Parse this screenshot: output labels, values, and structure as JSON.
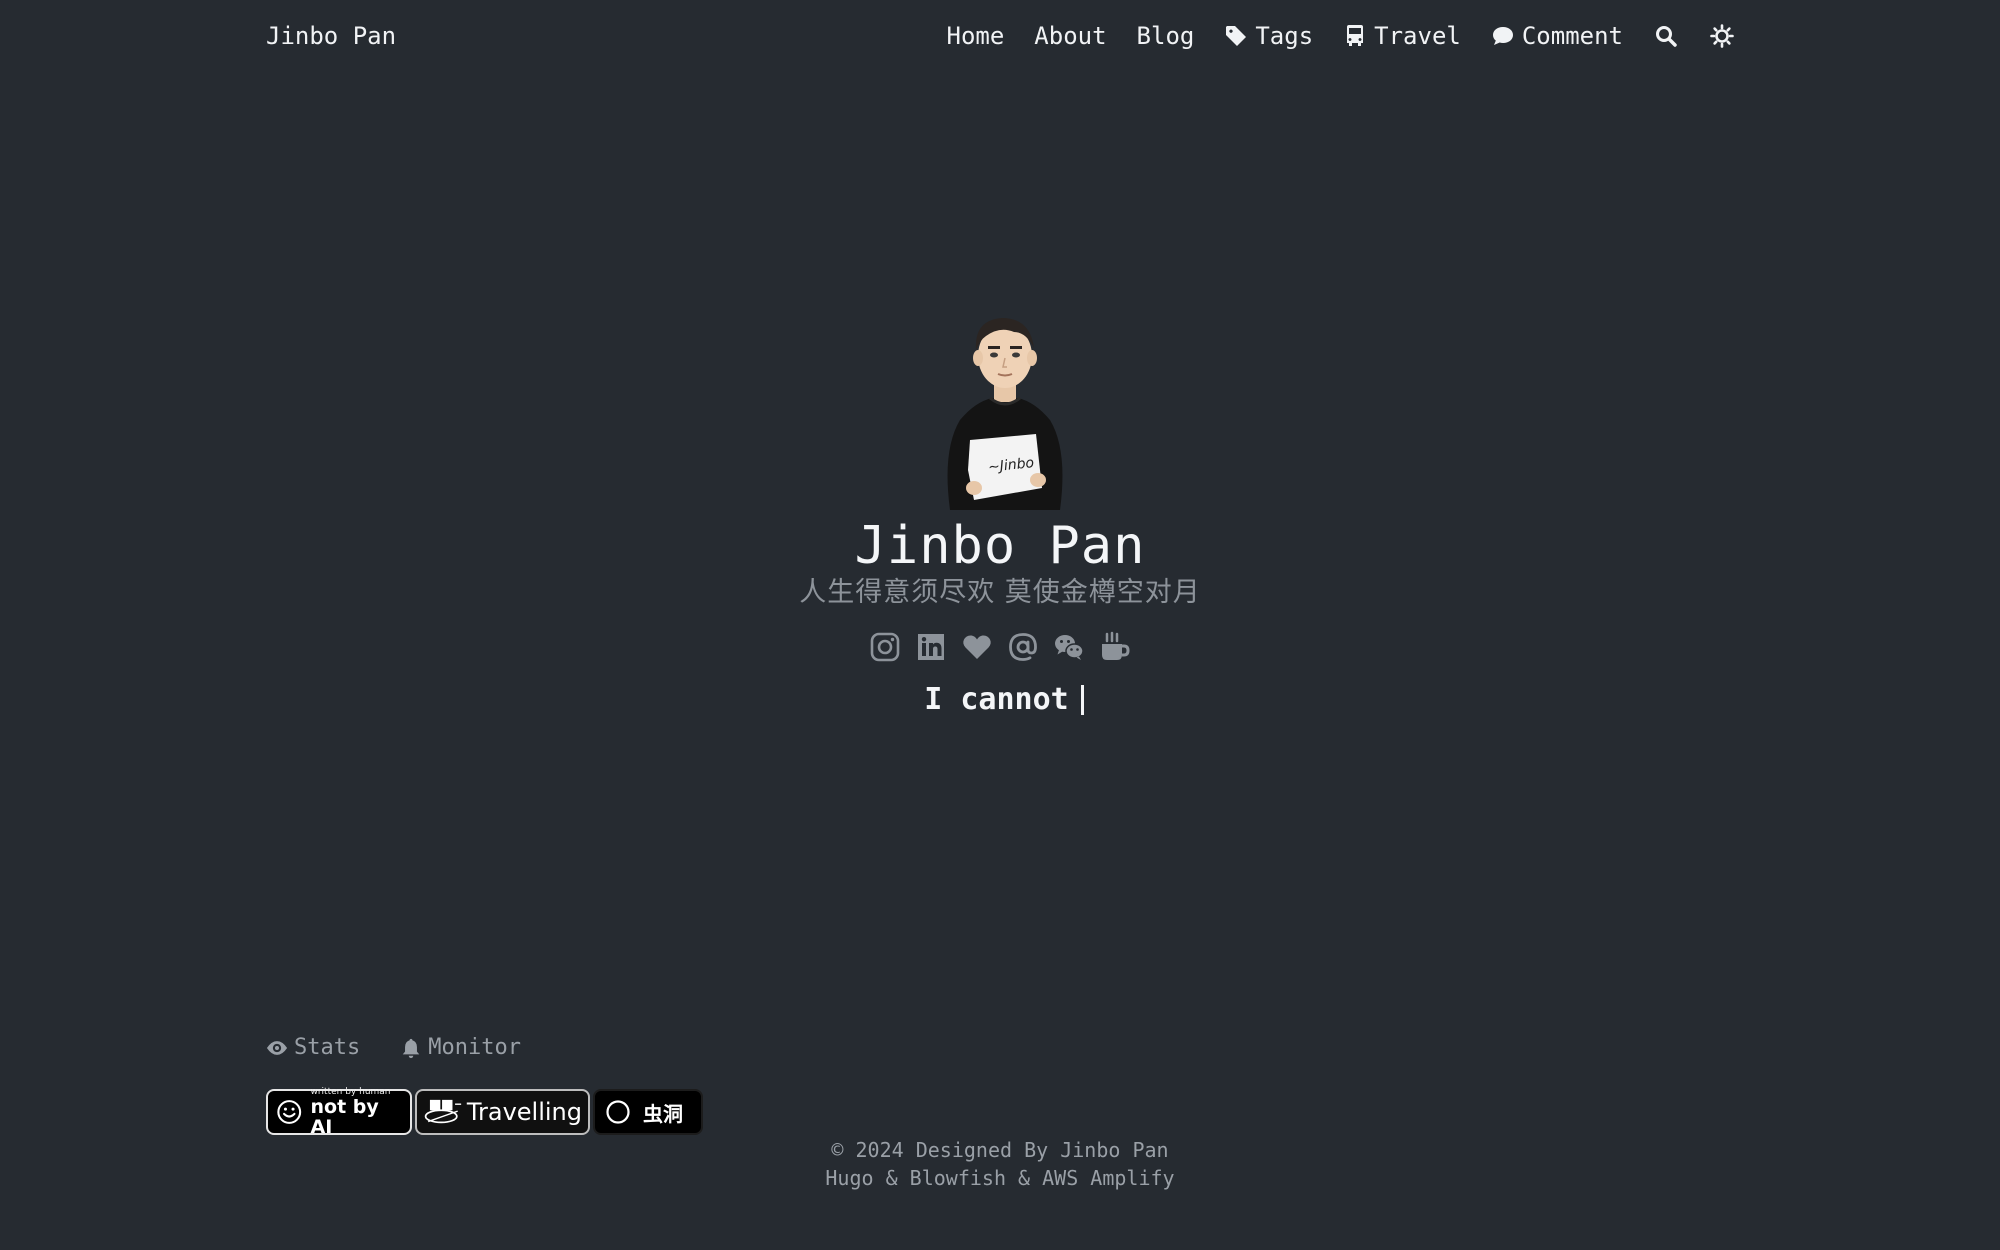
{
  "header": {
    "brand": "Jinbo Pan",
    "nav": [
      {
        "label": "Home",
        "icon": ""
      },
      {
        "label": "About",
        "icon": ""
      },
      {
        "label": "Blog",
        "icon": ""
      },
      {
        "label": "Tags",
        "icon": "tag-icon"
      },
      {
        "label": "Travel",
        "icon": "bus-icon"
      },
      {
        "label": "Comment",
        "icon": "comment-icon"
      }
    ],
    "search_icon": "search-icon",
    "theme_icon": "sun-icon"
  },
  "hero": {
    "title": "Jinbo Pan",
    "subtitle": "人生得意须尽欢  莫使金樽空对月",
    "socials": [
      "instagram-icon",
      "linkedin-icon",
      "heart-icon",
      "email-at-icon",
      "wechat-icon",
      "coffee-icon"
    ],
    "typed_text": "I cannot",
    "avatar_shirt_text": "~Jinbo"
  },
  "footer": {
    "links": [
      {
        "label": "Stats",
        "icon": "eye-icon"
      },
      {
        "label": "Monitor",
        "icon": "bell-icon"
      }
    ],
    "badges": {
      "notbyai": {
        "small": "written by human",
        "big": "not by AI"
      },
      "travelling": "Travelling",
      "wormhole": "虫洞"
    },
    "copyright_line1": "© 2024 Designed By Jinbo Pan",
    "copyright_line2": "Hugo & Blowfish & AWS Amplify"
  },
  "colors": {
    "background": "#262b31",
    "text": "#f1f3f5",
    "muted": "#8d939a"
  }
}
